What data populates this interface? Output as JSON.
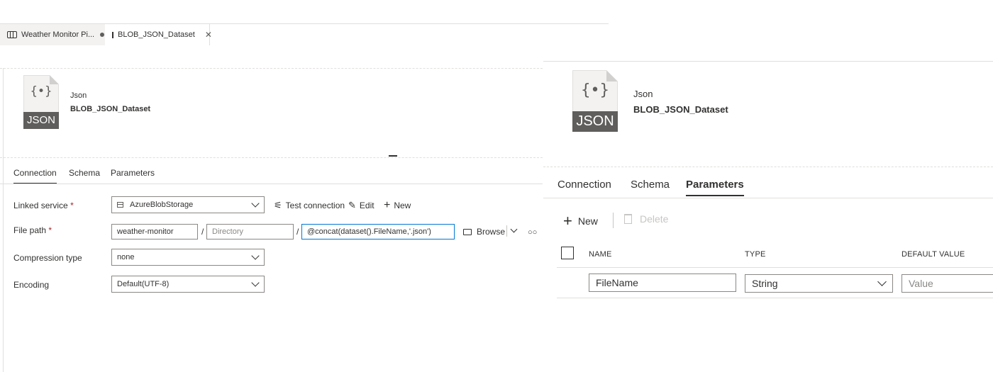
{
  "tabs": [
    {
      "label": "Weather Monitor Pi...",
      "icon": "pipeline-icon",
      "unsaved": true
    },
    {
      "label": "BLOB_JSON_Dataset",
      "icon": "table-icon",
      "closable": true
    }
  ],
  "dataset": {
    "icon_label": "JSON",
    "icon_braces": "{•}",
    "type": "Json",
    "name": "BLOB_JSON_Dataset"
  },
  "left_tabs": [
    "Connection",
    "Schema",
    "Parameters"
  ],
  "left_active_tab": "Connection",
  "form": {
    "linked_service": {
      "label": "Linked service",
      "required": "*",
      "value": "AzureBlobStorage"
    },
    "test_connection": "Test connection",
    "edit": "Edit",
    "new": "New",
    "file_path": {
      "label": "File path",
      "required": "*",
      "container": "weather-monitor",
      "directory_placeholder": "Directory",
      "file": "@concat(dataset().FileName,'.json')",
      "separator": "/",
      "browse": "Browse"
    },
    "compression_type": {
      "label": "Compression type",
      "value": "none"
    },
    "encoding": {
      "label": "Encoding",
      "value": "Default(UTF-8)"
    }
  },
  "right_tabs": [
    "Connection",
    "Schema",
    "Parameters"
  ],
  "right_active_tab": "Parameters",
  "params_toolbar": {
    "new": "New",
    "delete": "Delete"
  },
  "params_table": {
    "columns": [
      "NAME",
      "TYPE",
      "DEFAULT VALUE"
    ],
    "rows": [
      {
        "name": "FileName",
        "type": "String",
        "default_placeholder": "Value"
      }
    ]
  },
  "colors": {
    "border": "#e1dfdd",
    "input_border": "#8a8886",
    "focus": "#0078d4",
    "text": "#323130",
    "disabled": "#c8c6c4"
  }
}
